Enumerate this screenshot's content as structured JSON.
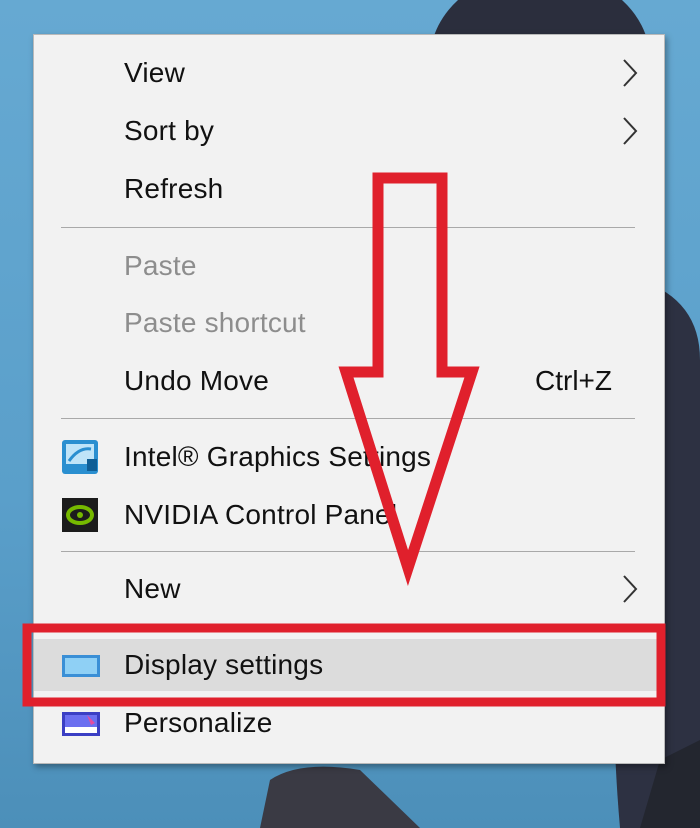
{
  "context_menu": {
    "items": [
      {
        "label": "View",
        "has_submenu": true,
        "enabled": true
      },
      {
        "label": "Sort by",
        "has_submenu": true,
        "enabled": true
      },
      {
        "label": "Refresh",
        "enabled": true
      },
      {
        "label": "Paste",
        "enabled": false
      },
      {
        "label": "Paste shortcut",
        "enabled": false
      },
      {
        "label": "Undo Move",
        "shortcut": "Ctrl+Z",
        "enabled": true
      },
      {
        "label": "Intel® Graphics Settings",
        "icon": "intel-graphics-icon",
        "enabled": true
      },
      {
        "label": "NVIDIA Control Panel",
        "icon": "nvidia-icon",
        "enabled": true
      },
      {
        "label": "New",
        "has_submenu": true,
        "enabled": true
      },
      {
        "label": "Display settings",
        "icon": "display-icon",
        "enabled": true,
        "highlighted": true
      },
      {
        "label": "Personalize",
        "icon": "personalize-icon",
        "enabled": true
      }
    ]
  },
  "annotation": {
    "arrow_color": "#e0202c",
    "box_color": "#e0202c",
    "arrow_points_to": "Display settings"
  },
  "colors": {
    "desktop_bg": "#5fa3cb",
    "menu_bg": "#f2f2f2",
    "highlight_bg": "#dcdcdc",
    "disabled_text": "#8d8d8d"
  }
}
